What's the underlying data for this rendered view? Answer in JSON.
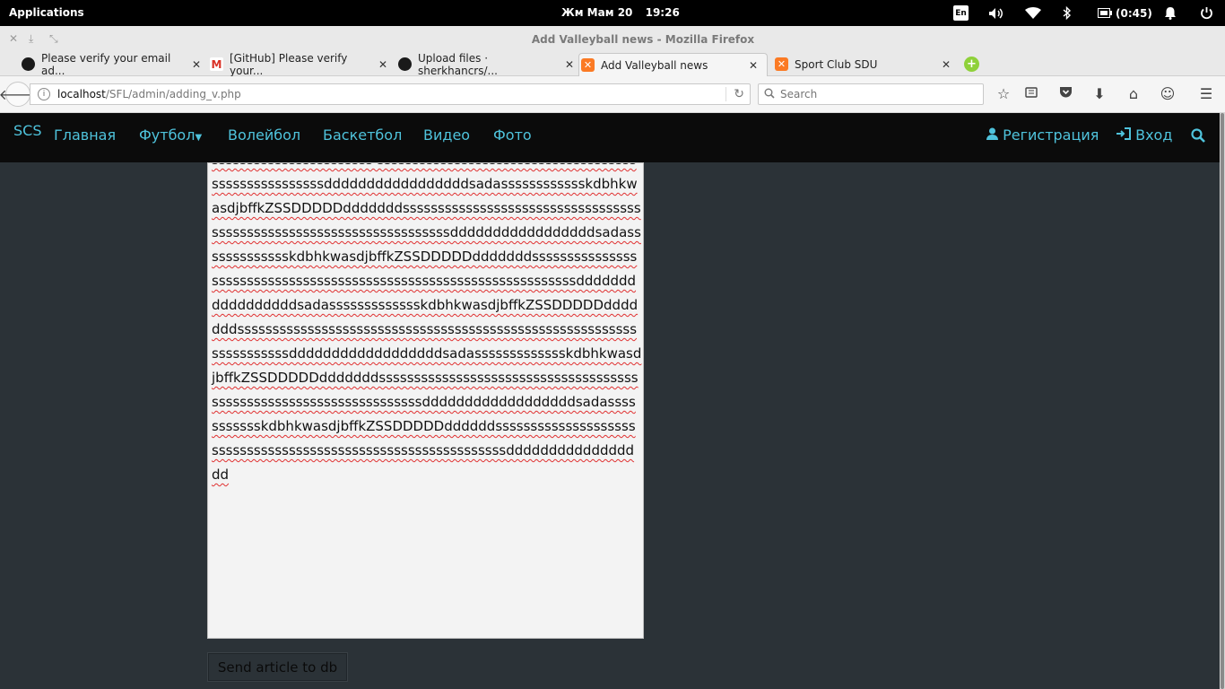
{
  "system_bar": {
    "applications": "Applications",
    "date": "Жм Мам 20",
    "time": "19:26",
    "lang": "En",
    "battery": "(0:45)"
  },
  "window": {
    "title": "Add Valleyball news - Mozilla Firefox"
  },
  "tabs": [
    {
      "label": "Please verify your email ad...",
      "icon": "github-icon"
    },
    {
      "label": "[GitHub] Please verify your...",
      "icon": "gmail-icon"
    },
    {
      "label": "Upload files · sherkhancrs/...",
      "icon": "github-icon"
    },
    {
      "label": "Add Valleyball news",
      "icon": "xampp-icon",
      "active": true
    },
    {
      "label": "Sport Club SDU",
      "icon": "xampp-icon"
    }
  ],
  "urlbar": {
    "host": "localhost",
    "path": "/SFL/admin/adding_v.php"
  },
  "search": {
    "placeholder": "Search"
  },
  "site": {
    "brand": "SCS",
    "nav": {
      "home": "Главная",
      "football": "Футбол",
      "volleyball": "Волейбол",
      "basketball": "Баскетбол",
      "video": "Видео",
      "photo": "Фото"
    },
    "register": "Регистрация",
    "login": "Вход",
    "accent_color": "#4fc3dc"
  },
  "editor": {
    "text": "sssssssssssssssssssssss sssssssssssssssssssssssssssssssssssssssssssssssssssssdddddddddddddddddsadasssssssssssskdbhkwasdjbffkZSSDDDDDdddddddssssssssssssssssssssssssssssssssssssssssssssssssssssssssssssssssssssdddddddddddddddddsadassssssssssssskdbhkwasdjbffkZSSDDDDDdddddddsssssssssssssssssssssssssssssssssssssssssssssssssssssssssssssssssssdddddddddddddddddsadassssssssssssskdbhkwasdjbffkZSSDDDDDdddddddssssssssssssssssssssssssssssssssssssssssssssssssssssssssssssssssssssddddddddddddddddddsadassssssssssssskdbhkwasdjbffkZSSDDDDDdddddddsssssssssssssssssssssssssssssssssssssssssssssssssssssssssssssssssssddddddddddddddddddsadassssssssssskdbhkwasdjbffkZSSDDDDDddddddssssssssssssssssssssssssssssssssssssssssssssssssssssssssssssssddddddddddddddddd"
  },
  "submit": {
    "label": "Send article to db"
  }
}
